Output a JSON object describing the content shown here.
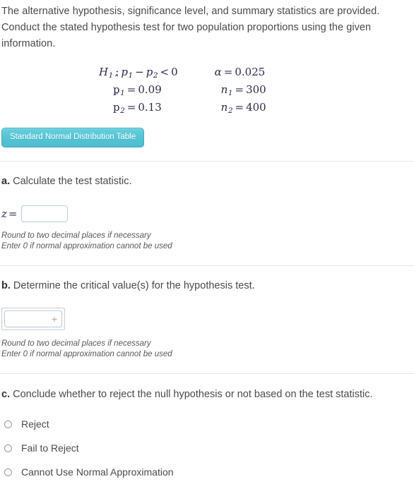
{
  "prompt": {
    "line1": "The alternative hypothesis, significance level, and summary statistics are provided.",
    "line2": "Conduct the stated hypothesis test for two population proportions using the given",
    "line3": "information."
  },
  "given": {
    "hypothesis": {
      "symbol": "H",
      "symbol_sub": "1",
      "colon": ":",
      "p1": "p",
      "p1_sub": "1",
      "minus": "−",
      "p2": "p",
      "p2_sub": "2",
      "relation": "<",
      "value": "0",
      "full_text": "H1 : p1 − p2 < 0"
    },
    "phat1": {
      "symbol": "p",
      "hat": "ˆ",
      "sub": "1",
      "equals": "=",
      "value": "0.09",
      "full_text": "p̂1 = 0.09"
    },
    "phat2": {
      "symbol": "p",
      "hat": "ˆ",
      "sub": "2",
      "equals": "=",
      "value": "0.13",
      "full_text": "p̂2 = 0.13"
    },
    "alpha": {
      "symbol": "α",
      "equals": "=",
      "value": "0.025",
      "full_text": "α = 0.025"
    },
    "n1": {
      "symbol": "n",
      "sub": "1",
      "equals": "=",
      "value": "300",
      "full_text": "n1 = 300"
    },
    "n2": {
      "symbol": "n",
      "sub": "2",
      "equals": "=",
      "value": "400",
      "full_text": "n2 = 400"
    }
  },
  "buttons": {
    "normal_table": "Standard Normal Distribution Table"
  },
  "sections": {
    "a": {
      "label": "a.",
      "question": "Calculate the test statistic.",
      "answer": {
        "prefix_symbol": "z",
        "prefix_equals": "=",
        "value": "",
        "placeholder": ""
      },
      "hints": [
        "Round to two decimal places if necessary",
        "Enter 0 if normal approximation cannot be used"
      ]
    },
    "b": {
      "label": "b.",
      "question": "Determine the critical value(s) for the hypothesis test.",
      "answer": {
        "value": "",
        "placeholder": "",
        "add_glyph": "+"
      },
      "hints": [
        "Round to two decimal places if necessary",
        "Enter 0 if normal approximation cannot be used"
      ]
    },
    "c": {
      "label": "c.",
      "question": "Conclude whether to reject the null hypothesis or not based on the test statistic.",
      "options": [
        {
          "label": "Reject",
          "selected": false
        },
        {
          "label": "Fail to Reject",
          "selected": false
        },
        {
          "label": "Cannot Use Normal Approximation",
          "selected": false
        }
      ]
    }
  },
  "colors": {
    "button_teal": "#54c3d4",
    "button_border": "#3ea9bd",
    "input_border": "#b9cde2",
    "divider": "#e6e6e6",
    "text": "#4a4a4a",
    "math_text": "#2c2c4a",
    "plus_glyph": "#b9a389"
  }
}
